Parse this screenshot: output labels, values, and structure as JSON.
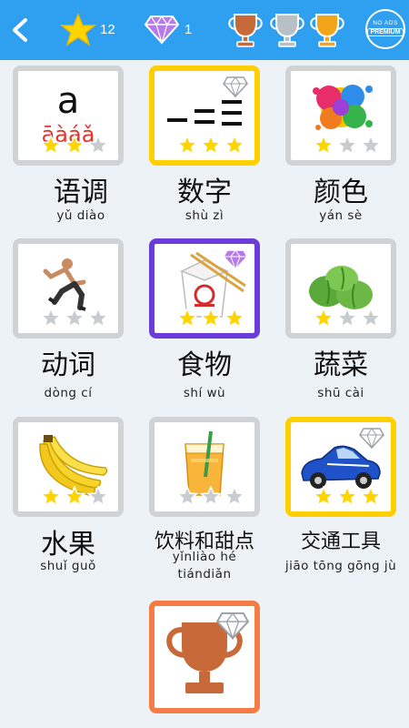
{
  "header": {
    "star_count": "12",
    "gem_count": "1",
    "premium_line1": "NO ADS",
    "premium_line2": "PREMIUM"
  },
  "lessons": [
    {
      "title": "语调",
      "pinyin": "yǔ diào"
    },
    {
      "title": "数字",
      "pinyin": "shù zì"
    },
    {
      "title": "颜色",
      "pinyin": "yán sè"
    },
    {
      "title": "动词",
      "pinyin": "dòng cí"
    },
    {
      "title": "食物",
      "pinyin": "shí wù"
    },
    {
      "title": "蔬菜",
      "pinyin": "shū cài"
    },
    {
      "title": "水果",
      "pinyin": "shuǐ guǒ"
    },
    {
      "title": "饮料和甜点",
      "pinyin_line1": "yǐnliào hé",
      "pinyin_line2": "tiándiǎn"
    },
    {
      "title": "交通工具",
      "pinyin": "jiāo tōng gōng jù"
    }
  ],
  "card_art": {
    "tones_letter": "a",
    "tones_marks": "āàáǎ",
    "numbers_dash": "–"
  },
  "colors": {
    "header_bg": "#2f9ff0",
    "page_bg": "#edf2f6",
    "gold_border": "#ffd000",
    "purple_border": "#6a3cd8",
    "gray_border": "#cfd3d6",
    "orange_border": "#f57c45"
  },
  "star_ratings": {
    "tones": 2,
    "numbers": 3,
    "colors": 1,
    "verbs": 0,
    "food": 3,
    "vegetables": 1,
    "fruit": 2,
    "drinks": 0,
    "transport": 3
  }
}
